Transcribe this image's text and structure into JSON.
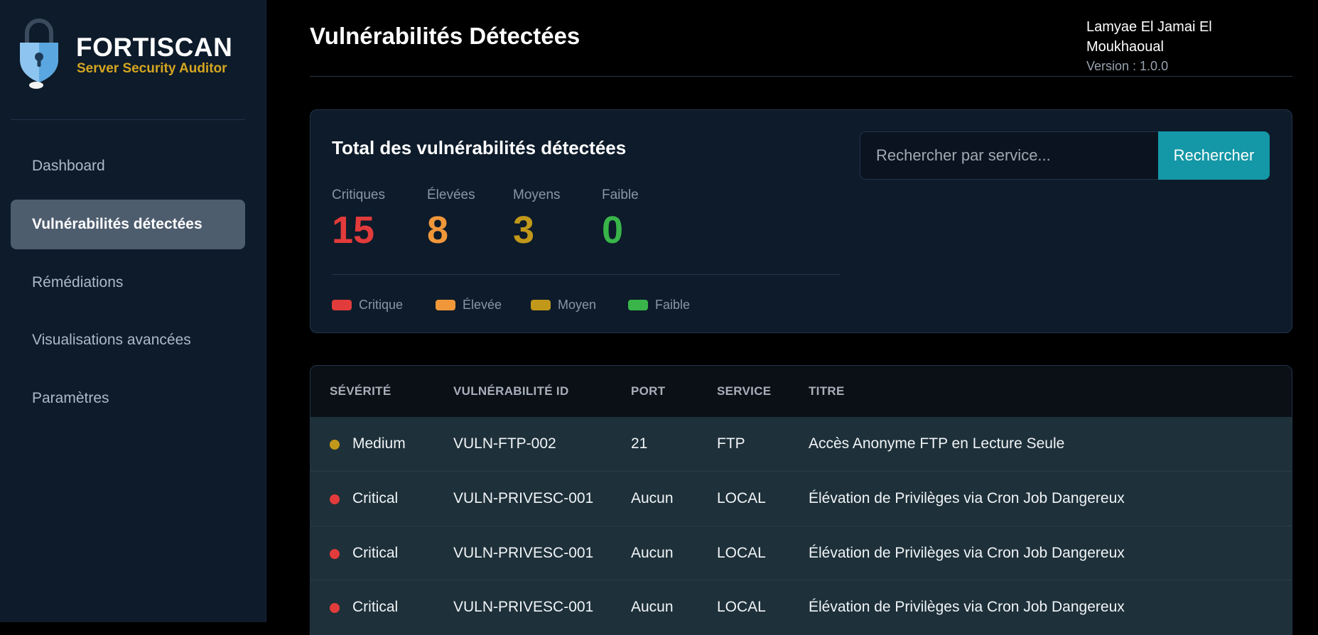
{
  "brand": {
    "name": "FORTISCAN",
    "subtitle": "Server Security Auditor"
  },
  "sidebar": {
    "items": [
      {
        "label": "Dashboard"
      },
      {
        "label": "Vulnérabilités détectées"
      },
      {
        "label": "Rémédiations"
      },
      {
        "label": "Visualisations avancées"
      },
      {
        "label": "Paramètres"
      }
    ],
    "active_item": "Vulnérabilités détectées"
  },
  "header": {
    "title": "Vulnérabilités Détectées",
    "user_name": "Lamyae El Jamai El Moukhaoual",
    "version": "Version : 1.0.0"
  },
  "summary": {
    "title": "Total des vulnérabilités détectées",
    "stats": [
      {
        "label": "Critiques",
        "value": "15",
        "color": "#e23b3b"
      },
      {
        "label": "Élevées",
        "value": "8",
        "color": "#f0973a"
      },
      {
        "label": "Moyens",
        "value": "3",
        "color": "#c2981a"
      },
      {
        "label": "Faible",
        "value": "0",
        "color": "#39b54a"
      }
    ],
    "legend": [
      {
        "label": "Critique",
        "color": "#e23b3b"
      },
      {
        "label": "Élevée",
        "color": "#f0973a"
      },
      {
        "label": "Moyen",
        "color": "#c2981a"
      },
      {
        "label": "Faible",
        "color": "#39b54a"
      }
    ]
  },
  "search": {
    "placeholder": "Rechercher par service...",
    "value": "",
    "button_label": "Rechercher"
  },
  "table": {
    "columns": [
      "SÉVÉRITÉ",
      "VULNÉRABILITÉ ID",
      "PORT",
      "SERVICE",
      "TITRE"
    ],
    "rows": [
      {
        "severity": "Medium",
        "severity_color": "#c2981a",
        "id": "VULN-FTP-002",
        "port": "21",
        "service": "FTP",
        "title": "Accès Anonyme FTP en Lecture Seule"
      },
      {
        "severity": "Critical",
        "severity_color": "#e23b3b",
        "id": "VULN-PRIVESC-001",
        "port": "Aucun",
        "service": "LOCAL",
        "title": "Élévation de Privilèges via Cron Job Dangereux"
      },
      {
        "severity": "Critical",
        "severity_color": "#e23b3b",
        "id": "VULN-PRIVESC-001",
        "port": "Aucun",
        "service": "LOCAL",
        "title": "Élévation de Privilèges via Cron Job Dangereux"
      },
      {
        "severity": "Critical",
        "severity_color": "#e23b3b",
        "id": "VULN-PRIVESC-001",
        "port": "Aucun",
        "service": "LOCAL",
        "title": "Élévation de Privilèges via Cron Job Dangereux"
      }
    ]
  },
  "icons": {
    "logo": "padlock-shield-logo",
    "severity_marker": "status-dot"
  }
}
